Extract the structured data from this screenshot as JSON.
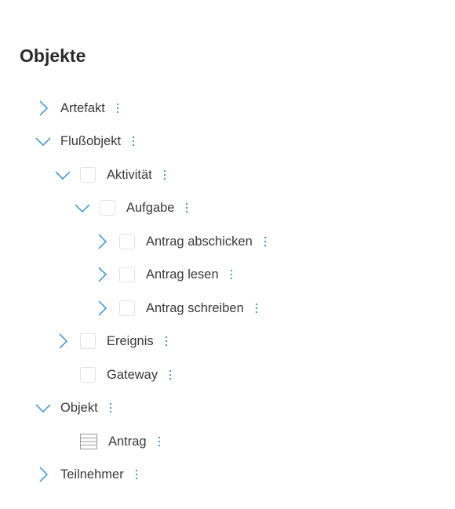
{
  "page": {
    "title": "Objekte"
  },
  "colors": {
    "accent": "#2b8fd6",
    "text": "#3a3a3a",
    "title": "#2b2b2b",
    "box_border": "#e3e3e3"
  },
  "tree": {
    "artefakt": {
      "label": "Artefakt",
      "state": "collapsed",
      "icon": "chevron-right-icon"
    },
    "flussobjekt": {
      "label": "Flußobjekt",
      "state": "expanded",
      "icon": "chevron-down-icon"
    },
    "aktivitaet": {
      "label": "Aktivität",
      "state": "expanded",
      "icon": "chevron-down-icon"
    },
    "aufgabe": {
      "label": "Aufgabe",
      "state": "expanded",
      "icon": "chevron-down-icon"
    },
    "antrag_abschicken": {
      "label": "Antrag abschicken",
      "state": "collapsed",
      "icon": "chevron-right-icon"
    },
    "antrag_lesen": {
      "label": "Antrag lesen",
      "state": "collapsed",
      "icon": "chevron-right-icon"
    },
    "antrag_schreiben": {
      "label": "Antrag schreiben",
      "state": "collapsed",
      "icon": "chevron-right-icon"
    },
    "ereignis": {
      "label": "Ereignis",
      "state": "collapsed",
      "icon": "chevron-right-icon"
    },
    "gateway": {
      "label": "Gateway",
      "state": "leaf"
    },
    "objekt": {
      "label": "Objekt",
      "state": "expanded",
      "icon": "chevron-down-icon"
    },
    "antrag": {
      "label": "Antrag",
      "state": "leaf",
      "icon": "table-icon"
    },
    "teilnehmer": {
      "label": "Teilnehmer",
      "state": "collapsed",
      "icon": "chevron-right-icon"
    }
  }
}
